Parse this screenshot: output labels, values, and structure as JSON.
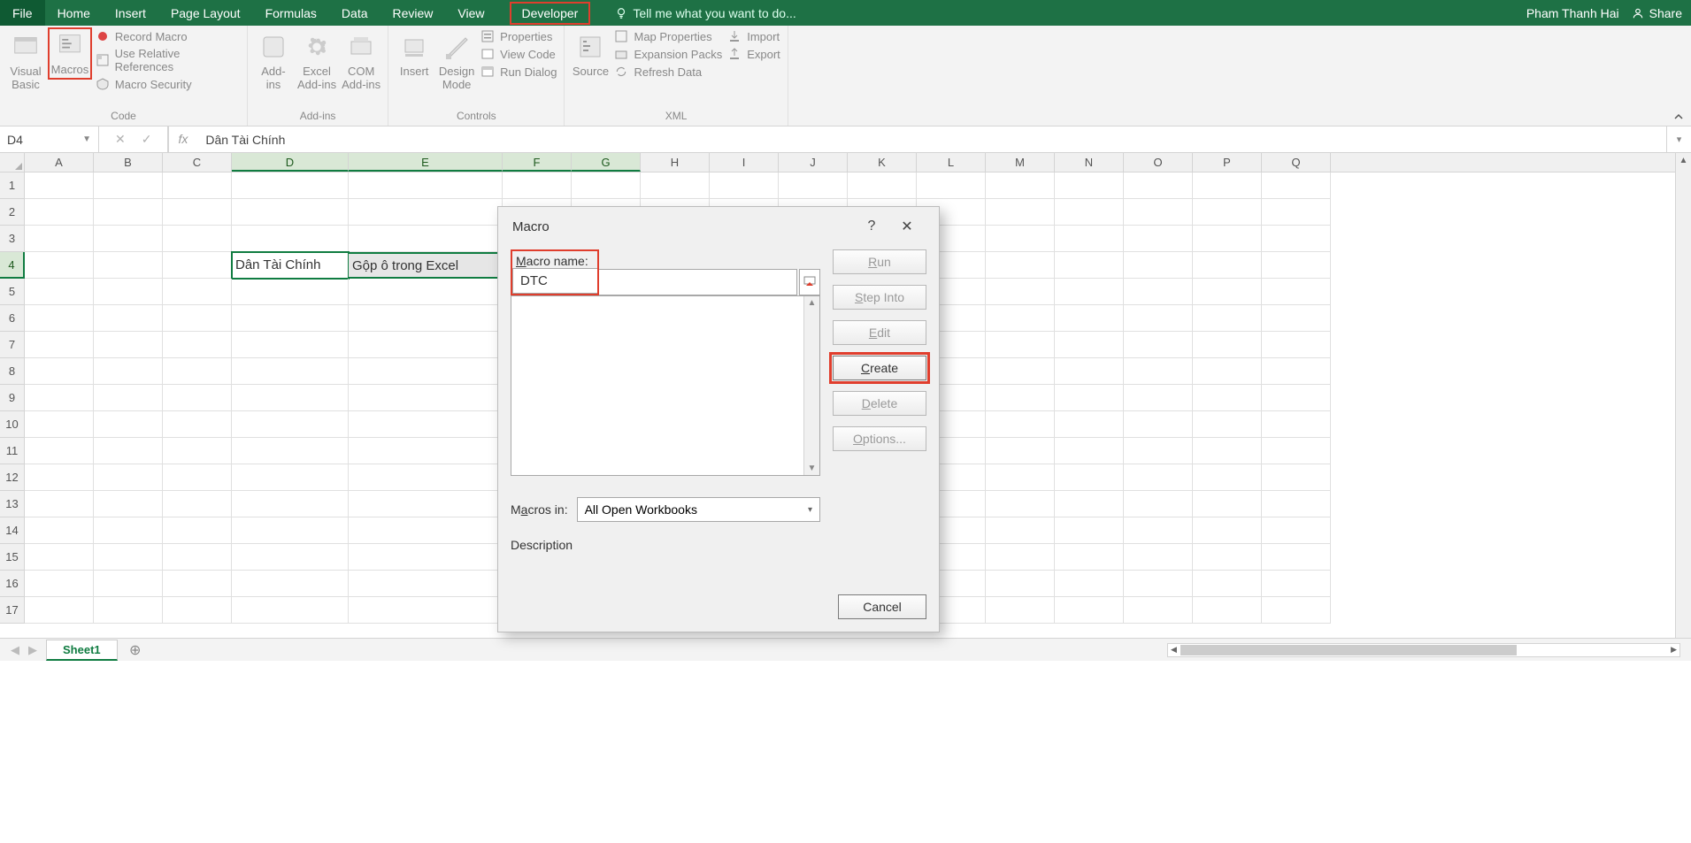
{
  "ribbon": {
    "tabs": {
      "file": "File",
      "home": "Home",
      "insert": "Insert",
      "page_layout": "Page Layout",
      "formulas": "Formulas",
      "data": "Data",
      "review": "Review",
      "view": "View",
      "developer": "Developer"
    },
    "tellme": "Tell me what you want to do...",
    "user": "Pham Thanh Hai",
    "share": "Share",
    "groups": {
      "code": {
        "label": "Code",
        "visual_basic": "Visual\nBasic",
        "macros": "Macros",
        "record_macro": "Record Macro",
        "use_relative": "Use Relative References",
        "macro_security": "Macro Security"
      },
      "addins": {
        "label": "Add-ins",
        "addins": "Add-\nins",
        "excel_addins": "Excel\nAdd-ins",
        "com_addins": "COM\nAdd-ins"
      },
      "controls": {
        "label": "Controls",
        "insert": "Insert",
        "design_mode": "Design\nMode",
        "properties": "Properties",
        "view_code": "View Code",
        "run_dialog": "Run Dialog"
      },
      "xml": {
        "label": "XML",
        "source": "Source",
        "map_properties": "Map Properties",
        "expansion_packs": "Expansion Packs",
        "refresh_data": "Refresh Data",
        "import": "Import",
        "export": "Export"
      }
    }
  },
  "formula_bar": {
    "name_box": "D4",
    "fx": "fx",
    "formula": "Dân Tài Chính"
  },
  "grid": {
    "cols": [
      "A",
      "B",
      "C",
      "D",
      "E",
      "F",
      "G",
      "H",
      "I",
      "J",
      "K",
      "L",
      "M",
      "N",
      "O",
      "P",
      "Q"
    ],
    "rows": [
      "1",
      "2",
      "3",
      "4",
      "5",
      "6",
      "7",
      "8",
      "9",
      "10",
      "11",
      "12",
      "13",
      "14",
      "15",
      "16",
      "17"
    ],
    "cells": {
      "D4": "Dân Tài Chính",
      "E4": "Gộp ô trong Excel"
    },
    "sheet_tab": "Sheet1"
  },
  "dialog": {
    "title": "Macro",
    "macro_name_label": "Macro name:",
    "macro_name_value": "DTC",
    "macros_in_label": "Macros in:",
    "macros_in_value": "All Open Workbooks",
    "description_label": "Description",
    "buttons": {
      "run": "Run",
      "step_into": "Step Into",
      "edit": "Edit",
      "create": "Create",
      "delete": "Delete",
      "options": "Options...",
      "cancel": "Cancel"
    }
  }
}
